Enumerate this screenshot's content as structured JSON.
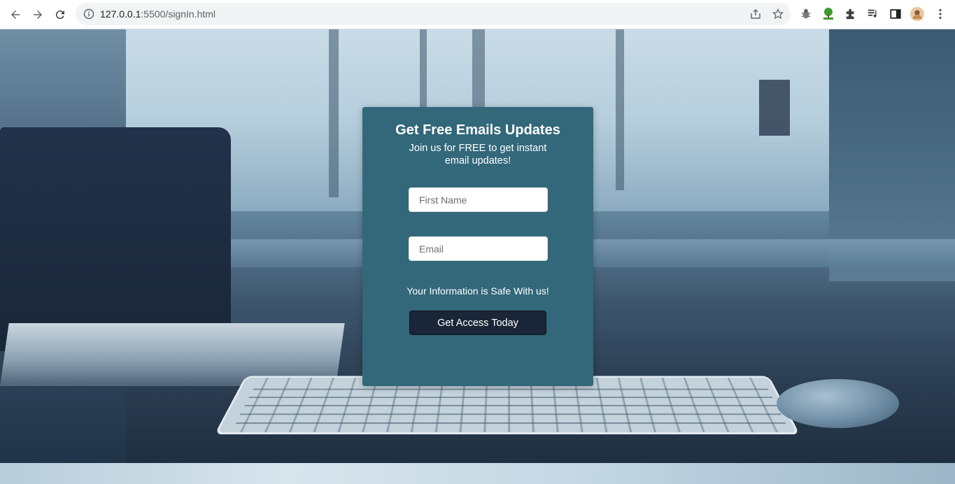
{
  "browser": {
    "url_host": "127.0.0.1",
    "url_path": ":5500/signIn.html",
    "back_icon": "arrow-left-icon",
    "forward_icon": "arrow-right-icon",
    "reload_icon": "reload-icon",
    "site_info_icon": "info-icon",
    "share_icon": "share-icon",
    "bookmark_icon": "star-icon",
    "extensions": [
      "bug-icon",
      "tree-extension-icon",
      "puzzle-icon",
      "media-icon",
      "sidepanel-icon"
    ],
    "profile_icon": "avatar",
    "menu_icon": "kebab-menu-icon"
  },
  "form": {
    "title": "Get Free Emails Updates",
    "subtitle": "Join us for FREE to get instant email updates!",
    "first_name_placeholder": "First Name",
    "email_placeholder": "Email",
    "safe_note": "Your Information is Safe With us!",
    "submit_label": "Get Access Today"
  },
  "colors": {
    "card": "#32687a",
    "button": "#1a2637",
    "text": "#ffffff"
  }
}
